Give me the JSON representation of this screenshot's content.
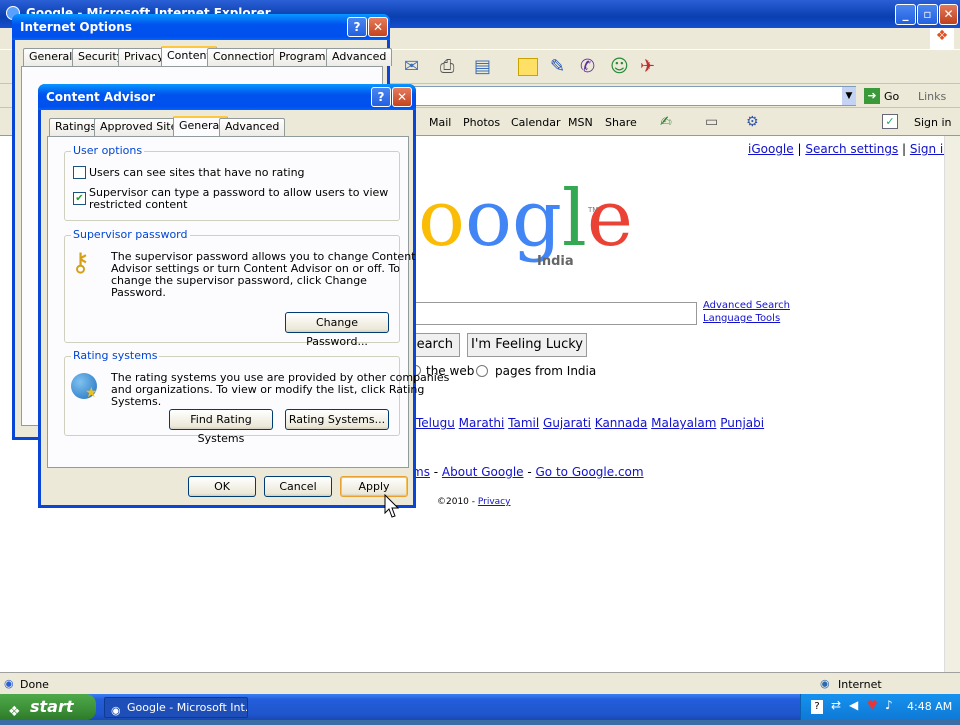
{
  "ie": {
    "title": "Google - Microsoft Internet Explorer",
    "address_go": "Go",
    "address_links": "Links",
    "links_bar": [
      "Mail",
      "Photos",
      "Calendar",
      "MSN",
      "Share"
    ],
    "signin": "Sign in",
    "status": "Done",
    "zone": "Internet"
  },
  "google": {
    "top_links": [
      "iGoogle",
      "Search settings",
      "Sign in"
    ],
    "logo_letters": "oogle",
    "logo_region": "India",
    "tm": "TM",
    "advanced_search": "Advanced Search",
    "language_tools": "Language Tools",
    "search_button": "earch",
    "lucky_button": "I'm Feeling Lucky",
    "radio_web": "the web",
    "radio_india": "pages from India",
    "languages": [
      "Telugu",
      "Marathi",
      "Tamil",
      "Gujarati",
      "Kannada",
      "Malayalam",
      "Punjabi"
    ],
    "bottom_links": [
      "ms",
      "About Google",
      "Go to Google.com"
    ],
    "copyright": "©2010 - ",
    "privacy": "Privacy"
  },
  "internet_options": {
    "title": "Internet Options",
    "tabs": [
      "General",
      "Security",
      "Privacy",
      "Content",
      "Connections",
      "Programs",
      "Advanced"
    ],
    "active_tab": "Content"
  },
  "content_advisor": {
    "title": "Content Advisor",
    "tabs": [
      "Ratings",
      "Approved Sites",
      "General",
      "Advanced"
    ],
    "active_tab": "General",
    "user_options": {
      "label": "User options",
      "opt1": "Users can see sites that have no rating",
      "opt1_checked": false,
      "opt2_line1": "Supervisor can type a password to allow users to view",
      "opt2_line2": "restricted content",
      "opt2_checked": true
    },
    "supervisor": {
      "label": "Supervisor password",
      "text_lines": [
        "The supervisor password allows you to change Content",
        "Advisor settings or turn Content Advisor on or off. To",
        "change the supervisor password, click Change",
        "Password."
      ],
      "button": "Change Password..."
    },
    "rating": {
      "label": "Rating systems",
      "text_lines": [
        "The rating systems you use are provided by other companies",
        "and organizations. To view or modify the list, click Rating",
        "Systems."
      ],
      "find_button": "Find Rating Systems",
      "systems_button": "Rating Systems..."
    },
    "ok": "OK",
    "cancel": "Cancel",
    "apply": "Apply"
  },
  "taskbar": {
    "start": "start",
    "item": "Google - Microsoft Int...",
    "clock": "4:48 AM"
  },
  "colors": {
    "xp_blue": "#0054e3",
    "start_green": "#3c8f37",
    "group_label": "#0046d5",
    "link": "#1111cc"
  }
}
